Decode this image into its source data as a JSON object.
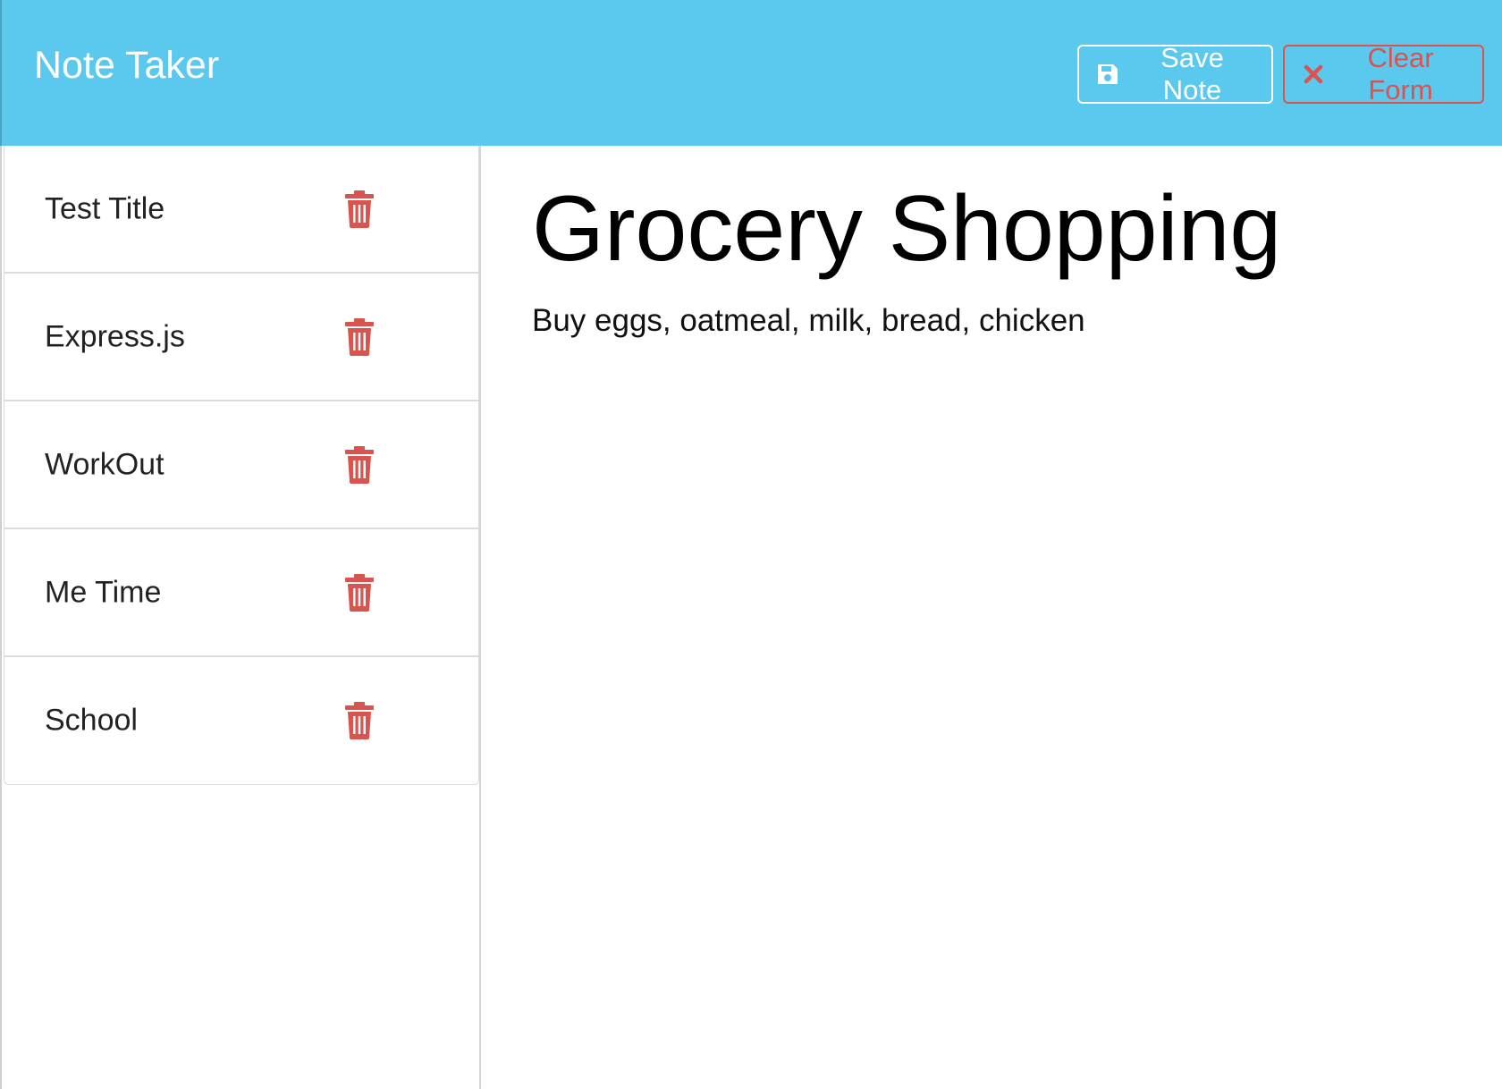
{
  "app": {
    "title": "Note Taker"
  },
  "toolbar": {
    "save_label": "Save Note",
    "save_icon": "floppy-disk-icon",
    "clear_label": "Clear Form",
    "clear_icon": "x-icon"
  },
  "colors": {
    "navbar": "#5bc8ee",
    "danger": "#d9534f",
    "white": "#ffffff"
  },
  "sidebar": {
    "notes": [
      {
        "title": "Test Title",
        "delete_icon": "trash-icon"
      },
      {
        "title": "Express.js",
        "delete_icon": "trash-icon"
      },
      {
        "title": "WorkOut",
        "delete_icon": "trash-icon"
      },
      {
        "title": "Me Time",
        "delete_icon": "trash-icon"
      },
      {
        "title": "School",
        "delete_icon": "trash-icon"
      }
    ]
  },
  "editor": {
    "title": "Grocery Shopping",
    "text": "Buy eggs, oatmeal, milk, bread, chicken"
  }
}
